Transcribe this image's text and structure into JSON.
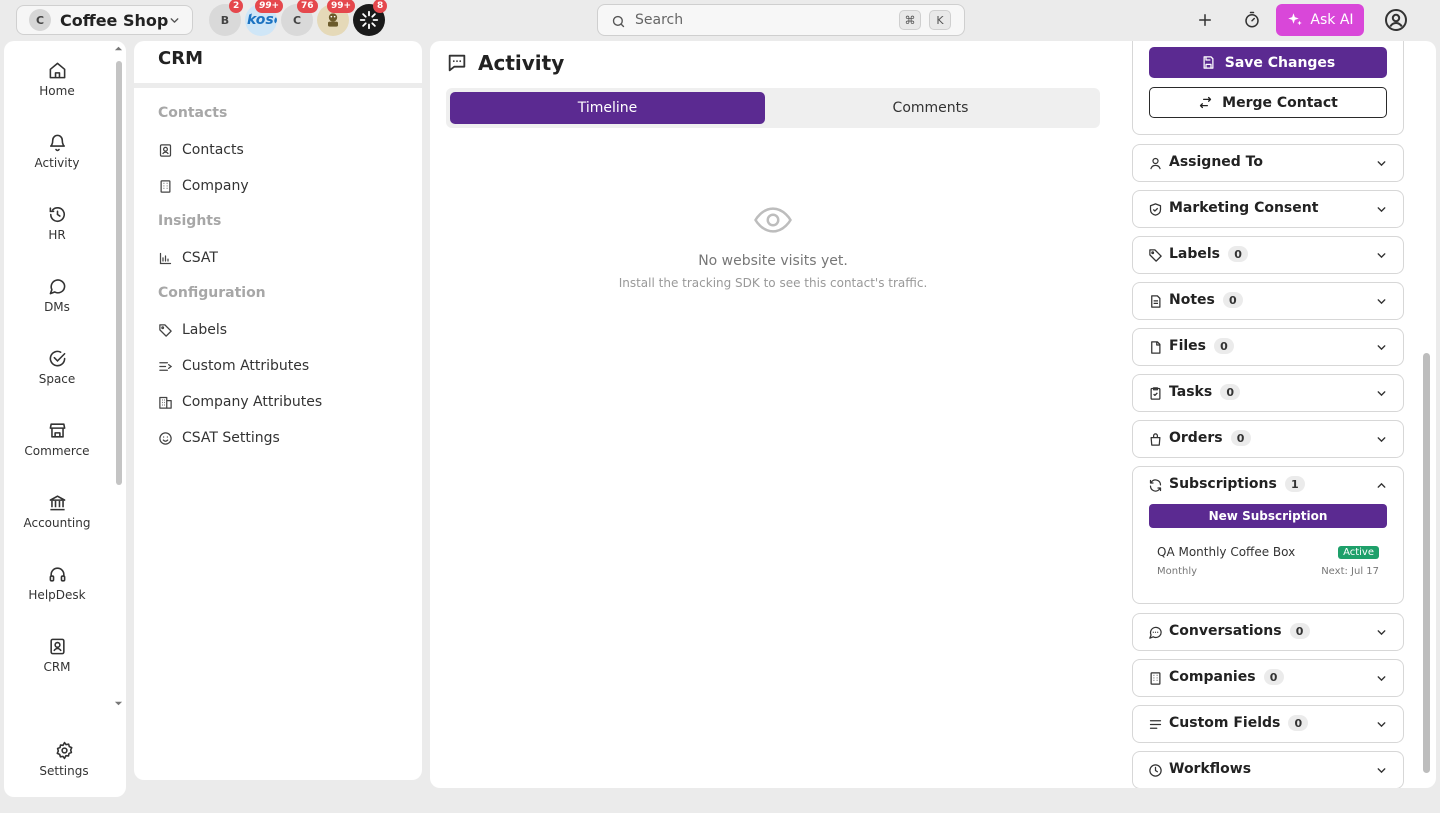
{
  "topbar": {
    "workspace": {
      "initial": "C",
      "name": "Coffee Shop"
    },
    "workspaces": [
      {
        "initial": "B",
        "badge": "2",
        "bg": "#d9d9d9",
        "fg": "#444444"
      },
      {
        "initial": "kosc",
        "badge": "99+",
        "bg": "#cfe6f7",
        "fg": "#1b73c2"
      },
      {
        "initial": "C",
        "badge": "76",
        "bg": "#d9d9d9",
        "fg": "#444444"
      },
      {
        "initial": "",
        "badge": "99+",
        "bg": "#e5d9b8",
        "fg": "#444444"
      },
      {
        "initial": "",
        "badge": "8",
        "bg": "#1a1a1a",
        "fg": "#ffffff"
      }
    ],
    "search": {
      "placeholder": "Search",
      "shortcut_mod": "⌘",
      "shortcut_key": "K"
    },
    "ask_ai_label": "Ask AI"
  },
  "leftnav": {
    "items": [
      {
        "label": "Home",
        "icon": "home-icon"
      },
      {
        "label": "Activity",
        "icon": "bell-icon"
      },
      {
        "label": "HR",
        "icon": "history-icon"
      },
      {
        "label": "DMs",
        "icon": "message-circle-icon"
      },
      {
        "label": "Space",
        "icon": "check-circle-icon"
      },
      {
        "label": "Commerce",
        "icon": "store-icon"
      },
      {
        "label": "Accounting",
        "icon": "bank-icon"
      },
      {
        "label": "HelpDesk",
        "icon": "headset-icon"
      },
      {
        "label": "CRM",
        "icon": "contact-card-icon"
      }
    ],
    "settings_label": "Settings"
  },
  "crm": {
    "title": "CRM",
    "sections": [
      {
        "title": "Contacts",
        "items": [
          {
            "label": "Contacts"
          },
          {
            "label": "Company"
          }
        ]
      },
      {
        "title": "Insights",
        "items": [
          {
            "label": "CSAT"
          }
        ]
      },
      {
        "title": "Configuration",
        "items": [
          {
            "label": "Labels"
          },
          {
            "label": "Custom Attributes"
          },
          {
            "label": "Company Attributes"
          },
          {
            "label": "CSAT Settings"
          }
        ]
      }
    ]
  },
  "activity": {
    "title": "Activity",
    "tabs": {
      "timeline": "Timeline",
      "comments": "Comments"
    },
    "empty_title": "No website visits yet.",
    "empty_subtitle": "Install the tracking SDK to see this contact's traffic."
  },
  "sidebar": {
    "save_label": "Save Changes",
    "merge_label": "Merge Contact",
    "panels": {
      "assigned": {
        "label": "Assigned To"
      },
      "consent": {
        "label": "Marketing Consent"
      },
      "labels": {
        "label": "Labels",
        "count": "0"
      },
      "notes": {
        "label": "Notes",
        "count": "0"
      },
      "files": {
        "label": "Files",
        "count": "0"
      },
      "tasks": {
        "label": "Tasks",
        "count": "0"
      },
      "orders": {
        "label": "Orders",
        "count": "0"
      },
      "subscriptions": {
        "label": "Subscriptions",
        "count": "1"
      },
      "conversations": {
        "label": "Conversations",
        "count": "0"
      },
      "companies": {
        "label": "Companies",
        "count": "0"
      },
      "custom_fields": {
        "label": "Custom Fields",
        "count": "0"
      },
      "workflows": {
        "label": "Workflows"
      }
    },
    "new_subscription_label": "New Subscription",
    "subscription": {
      "name": "QA Monthly Coffee Box",
      "status": "Active",
      "frequency": "Monthly",
      "next": "Next: Jul 17"
    }
  },
  "colors": {
    "primary": "#5b2a91",
    "ask_ai": "#d947d9",
    "badge": "#e5484d",
    "status_active": "#1ea06a"
  }
}
